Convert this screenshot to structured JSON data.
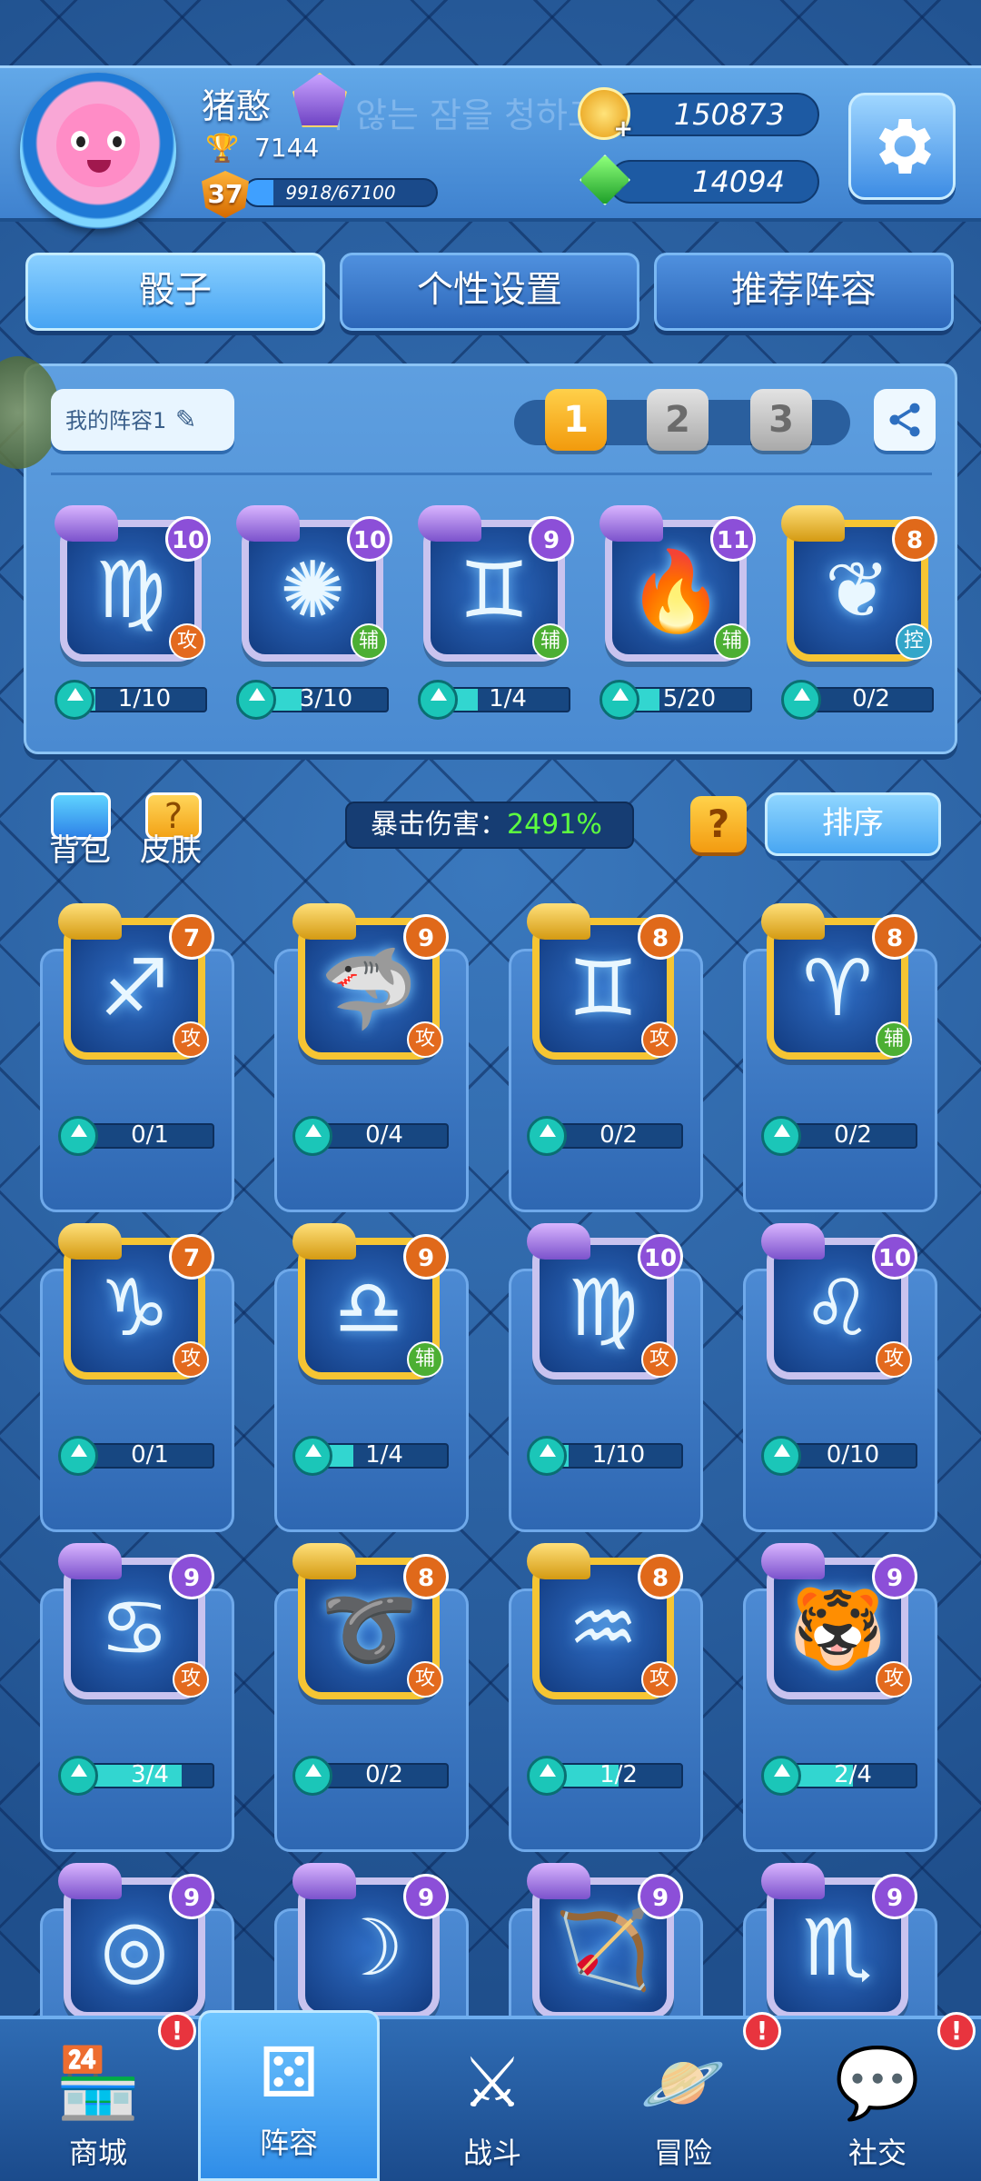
{
  "colors": {
    "accent": "#47a4f3",
    "gold": "#f6c533",
    "crit_value": "#5dff3f",
    "alert": "#e8343e"
  },
  "profile": {
    "name": "猪憨",
    "trophies": "7144",
    "level": "37",
    "xp_text": "9918/67100",
    "xp_fraction": 0.148,
    "ghost_text": "이 않는 잠을 청하고"
  },
  "currency": {
    "coins": "150873",
    "gems": "14094"
  },
  "tabs": [
    {
      "label": "骰子"
    },
    {
      "label": "个性设置"
    },
    {
      "label": "推荐阵容"
    }
  ],
  "loadout": {
    "team_label": "我的阵容1",
    "slots": [
      "1",
      "2",
      "3"
    ],
    "dice": [
      {
        "level": "10",
        "role": "攻",
        "progress": "1/10",
        "fraction": 0.1,
        "icon": "virgo-icon",
        "frame": "purple"
      },
      {
        "level": "10",
        "role": "辅",
        "progress": "3/10",
        "fraction": 0.3,
        "icon": "dandelion-icon",
        "frame": "purple"
      },
      {
        "level": "9",
        "role": "辅",
        "progress": "1/4",
        "fraction": 0.25,
        "icon": "twin-figure-icon",
        "frame": "purple"
      },
      {
        "level": "11",
        "role": "辅",
        "progress": "5/20",
        "fraction": 0.25,
        "icon": "fire-altar-icon",
        "frame": "purple"
      },
      {
        "level": "8",
        "role": "控",
        "progress": "0/2",
        "fraction": 0,
        "icon": "wings-icon",
        "frame": "gold"
      }
    ]
  },
  "toolbar": {
    "bag_label": "背包",
    "skin_label": "皮肤",
    "crit_label": "暴击伤害：",
    "crit_value": "2491%",
    "help_label": "?",
    "sort_label": "排序"
  },
  "collection": [
    {
      "level": "7",
      "role": "攻",
      "progress": "0/1",
      "fraction": 0,
      "icon": "sagittarius-icon",
      "frame": "gold"
    },
    {
      "level": "9",
      "role": "攻",
      "progress": "0/4",
      "fraction": 0,
      "icon": "shark-icon",
      "frame": "gold"
    },
    {
      "level": "8",
      "role": "攻",
      "progress": "0/2",
      "fraction": 0,
      "icon": "gemini-icon",
      "frame": "gold"
    },
    {
      "level": "8",
      "role": "辅",
      "progress": "0/2",
      "fraction": 0,
      "icon": "aries-icon",
      "frame": "gold"
    },
    {
      "level": "7",
      "role": "攻",
      "progress": "0/1",
      "fraction": 0,
      "icon": "capricorn-icon",
      "frame": "gold"
    },
    {
      "level": "9",
      "role": "辅",
      "progress": "1/4",
      "fraction": 0.25,
      "icon": "libra-icon",
      "frame": "gold"
    },
    {
      "level": "10",
      "role": "攻",
      "progress": "1/10",
      "fraction": 0.1,
      "icon": "virgo-icon",
      "frame": "purple"
    },
    {
      "level": "10",
      "role": "攻",
      "progress": "0/10",
      "fraction": 0,
      "icon": "leo-icon",
      "frame": "purple"
    },
    {
      "level": "9",
      "role": "攻",
      "progress": "3/4",
      "fraction": 0.75,
      "icon": "cancer-icon",
      "frame": "purple"
    },
    {
      "level": "8",
      "role": "攻",
      "progress": "0/2",
      "fraction": 0,
      "icon": "swirl-icon",
      "frame": "gold"
    },
    {
      "level": "8",
      "role": "攻",
      "progress": "1/2",
      "fraction": 0.5,
      "icon": "aquarius-icon",
      "frame": "gold"
    },
    {
      "level": "9",
      "role": "攻",
      "progress": "2/4",
      "fraction": 0.5,
      "icon": "tiger-icon",
      "frame": "purple"
    },
    {
      "level": "9",
      "icon": "target-icon",
      "frame": "purple"
    },
    {
      "level": "9",
      "icon": "sorceress-icon",
      "frame": "purple"
    },
    {
      "level": "9",
      "icon": "archer-icon",
      "frame": "purple"
    },
    {
      "level": "9",
      "icon": "scorpio-icon",
      "frame": "purple"
    }
  ],
  "nav": [
    {
      "label": "商城",
      "icon": "shop-icon",
      "alert": "!"
    },
    {
      "label": "阵容",
      "icon": "dice-icon"
    },
    {
      "label": "战斗",
      "icon": "swords-icon"
    },
    {
      "label": "冒险",
      "icon": "planet-icon",
      "alert": "!"
    },
    {
      "label": "社交",
      "icon": "chat-icon",
      "alert": "!"
    }
  ]
}
